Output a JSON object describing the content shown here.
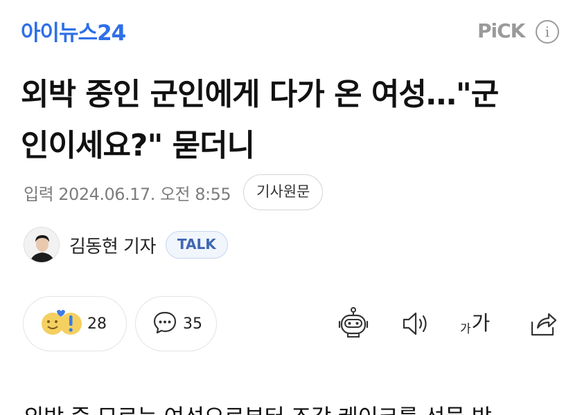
{
  "header": {
    "logo": "아이뉴스24",
    "pick_label": "PiCK",
    "info_icon": "info-icon",
    "info_glyph": "i"
  },
  "article": {
    "title": "외박 중인 군인에게 다가 온 여성…\"군인이세요?\" 묻더니",
    "date": "입력 2024.06.17. 오전 8:55",
    "original_button": "기사원문",
    "author": "김동현 기자",
    "talk_badge": "TALK",
    "body_preview": "외박 중 모르는 여성으로부터 조각 케이크를 선물 받"
  },
  "toolbar": {
    "reaction_count": "28",
    "comment_count": "35",
    "icons": [
      "reaction-emoji-icon",
      "comment-icon",
      "summary-bot-icon",
      "speaker-icon",
      "font-size-icon",
      "share-icon"
    ],
    "font_small": "가",
    "font_big": "가"
  },
  "colors": {
    "logo_blue": "#2f6fe8",
    "pick_gray": "#9a9a9a",
    "talk_text": "#3f68b3",
    "talk_bg": "#f1f5fc"
  }
}
